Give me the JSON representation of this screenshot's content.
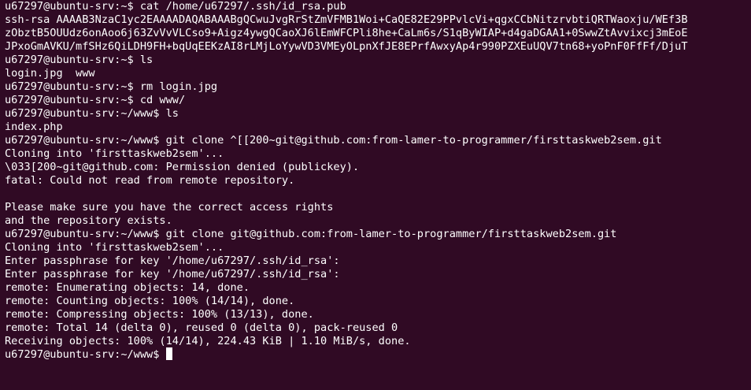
{
  "terminal": {
    "lines": [
      "u67297@ubuntu-srv:~$ cat /home/u67297/.ssh/id_rsa.pub",
      "ssh-rsa AAAAB3NzaC1yc2EAAAADAQABAAABgQCwuJvgRrStZmVFMB1Woi+CaQE82E29PPvlcVi+qgxCCbNitzrvbtiQRTWaoxju/WEf3B",
      "zObztB5OUUdz6onAoo6j63ZvVvVLCso9+Aigz4ywgQCaoXJ6lEmWFCPli8he+CaLm6s/S1qByWIAP+d4gaDGAA1+0SwwZtAvvixcj3mEoE",
      "JPxoGmAVKU/mfSHz6QiLDH9FH+bqUqEEKzAI8rLMjLoYywVD3VMEyOLpnXfJE8EPrfAwxyAp4r990PZXEuUQV7tn68+yoPnF0FfFf/DjuT",
      "u67297@ubuntu-srv:~$ ls",
      "login.jpg  www",
      "u67297@ubuntu-srv:~$ rm login.jpg",
      "u67297@ubuntu-srv:~$ cd www/",
      "u67297@ubuntu-srv:~/www$ ls",
      "index.php",
      "u67297@ubuntu-srv:~/www$ git clone ^[[200~git@github.com:from-lamer-to-programmer/firsttaskweb2sem.git",
      "Cloning into 'firsttaskweb2sem'...",
      "\\033[200~git@github.com: Permission denied (publickey).",
      "fatal: Could not read from remote repository.",
      "",
      "Please make sure you have the correct access rights",
      "and the repository exists.",
      "u67297@ubuntu-srv:~/www$ git clone git@github.com:from-lamer-to-programmer/firsttaskweb2sem.git",
      "Cloning into 'firsttaskweb2sem'...",
      "Enter passphrase for key '/home/u67297/.ssh/id_rsa':",
      "Enter passphrase for key '/home/u67297/.ssh/id_rsa':",
      "remote: Enumerating objects: 14, done.",
      "remote: Counting objects: 100% (14/14), done.",
      "remote: Compressing objects: 100% (13/13), done.",
      "remote: Total 14 (delta 0), reused 0 (delta 0), pack-reused 0",
      "Receiving objects: 100% (14/14), 224.43 KiB | 1.10 MiB/s, done."
    ],
    "prompt": "u67297@ubuntu-srv:~/www$ "
  },
  "colors": {
    "background": "#300a24",
    "foreground": "#ffffff"
  }
}
